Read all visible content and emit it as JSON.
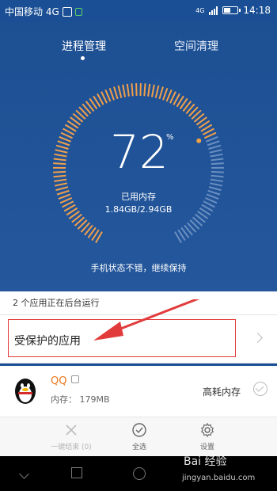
{
  "status_bar": {
    "carrier": "中国移动 4G",
    "network": "4G",
    "time": "14:18"
  },
  "tabs": [
    {
      "label": "进程管理"
    },
    {
      "label": "空间清理"
    }
  ],
  "memory": {
    "percent": "72",
    "percent_sign": "%",
    "label": "已用内存",
    "value": "1.84GB/2.94GB",
    "used_fraction": 0.72
  },
  "status_message": "手机状态不错，继续保持",
  "background_info": "2 个应用正在后台运行",
  "protected_apps": {
    "label": "受保护的应用"
  },
  "apps": [
    {
      "name": "QQ",
      "memory": "内存： 179MB",
      "tag": "高耗内存"
    }
  ],
  "toolbar": [
    {
      "label": "一键结束 (0)"
    },
    {
      "label": "全选"
    },
    {
      "label": "设置"
    }
  ],
  "watermark": {
    "text": "Bai 经验",
    "sub": "jingyan.baidu.com"
  },
  "colors": {
    "header_bg": "#1d4f93",
    "gauge_active": "#f0a04b",
    "gauge_inactive": "#6a8fc1",
    "highlight_red": "#e23b3b",
    "app_name": "#e8761c"
  }
}
